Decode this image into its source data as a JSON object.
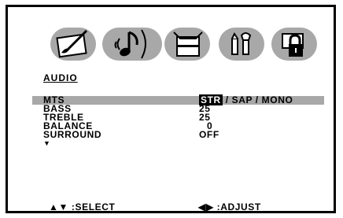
{
  "menu": {
    "tabs": [
      {
        "name": "picture",
        "icon": "brush-palette-icon"
      },
      {
        "name": "audio",
        "icon": "music-note-icon"
      },
      {
        "name": "setup",
        "icon": "box-icon"
      },
      {
        "name": "features",
        "icon": "tools-icon"
      },
      {
        "name": "lock",
        "icon": "padlock-icon"
      }
    ],
    "section_title": "AUDIO",
    "items": [
      {
        "label": "MTS",
        "value_prefix": "STR",
        "value": " / SAP / MONO",
        "selected": true
      },
      {
        "label": "BASS",
        "value": "25"
      },
      {
        "label": "TREBLE",
        "value": "25"
      },
      {
        "label": "BALANCE",
        "value": "0"
      },
      {
        "label": "SURROUND",
        "value": "OFF"
      }
    ],
    "more_indicator": "▼",
    "footer": {
      "select_arrows": "▲▼",
      "select_label": ":SELECT",
      "adjust_arrows": "◀▶",
      "adjust_label": ":ADJUST"
    }
  },
  "colors": {
    "tab_fill": "#a8a8a8",
    "highlight": "#a8a8a8",
    "text": "#000000",
    "background": "#ffffff"
  }
}
